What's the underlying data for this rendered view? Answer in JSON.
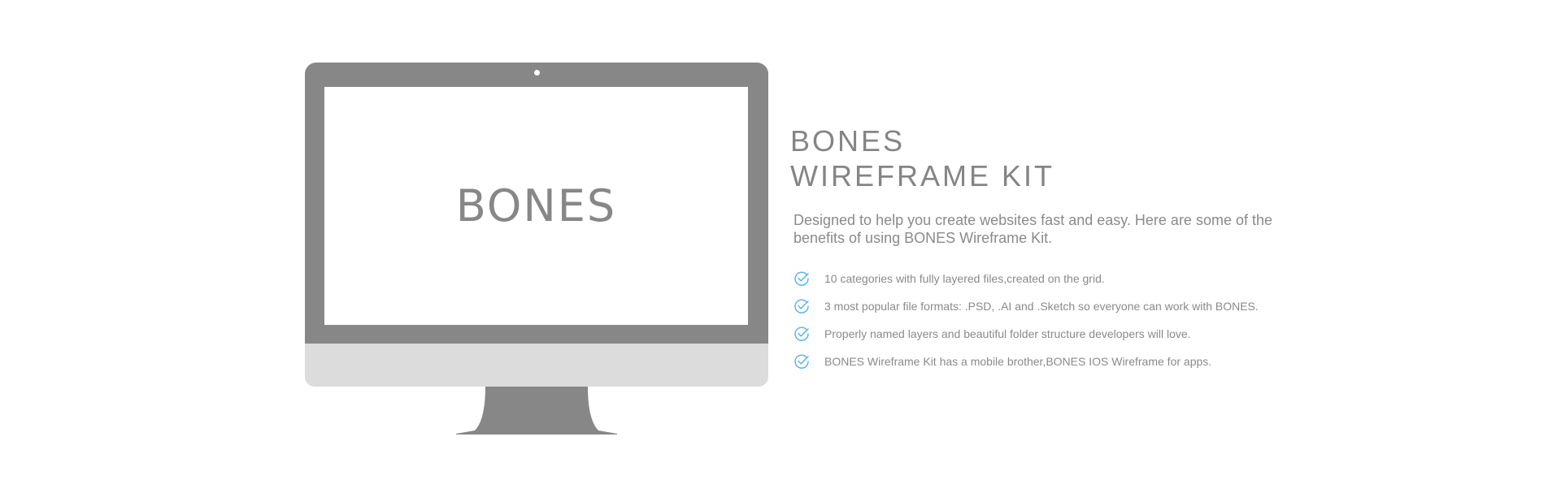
{
  "device": {
    "screen_logo": "BONES"
  },
  "info": {
    "title_line_1": "BONES",
    "title_line_2": "WIREFRAME KIT",
    "intro": "Designed to help you create websites fast and easy. Here are some of the benefits of using BONES Wireframe Kit.",
    "benefits": [
      {
        "icon": "check-circle-icon",
        "text": "10 categories with fully layered files,created on the grid."
      },
      {
        "icon": "check-circle-icon",
        "text": "3 most popular file formats: .PSD, .AI and .Sketch so everyone can work with BONES."
      },
      {
        "icon": "check-circle-icon",
        "text": "Properly named layers and beautiful folder structure developers will love."
      },
      {
        "icon": "check-circle-icon",
        "text": "BONES Wireframe Kit has a mobile brother,BONES IOS Wireframe for apps."
      }
    ]
  },
  "colors": {
    "device_gray": "#878787",
    "chin_gray": "#dcdcdc",
    "text_gray": "#878787",
    "check_blue": "#4fb3e8"
  }
}
